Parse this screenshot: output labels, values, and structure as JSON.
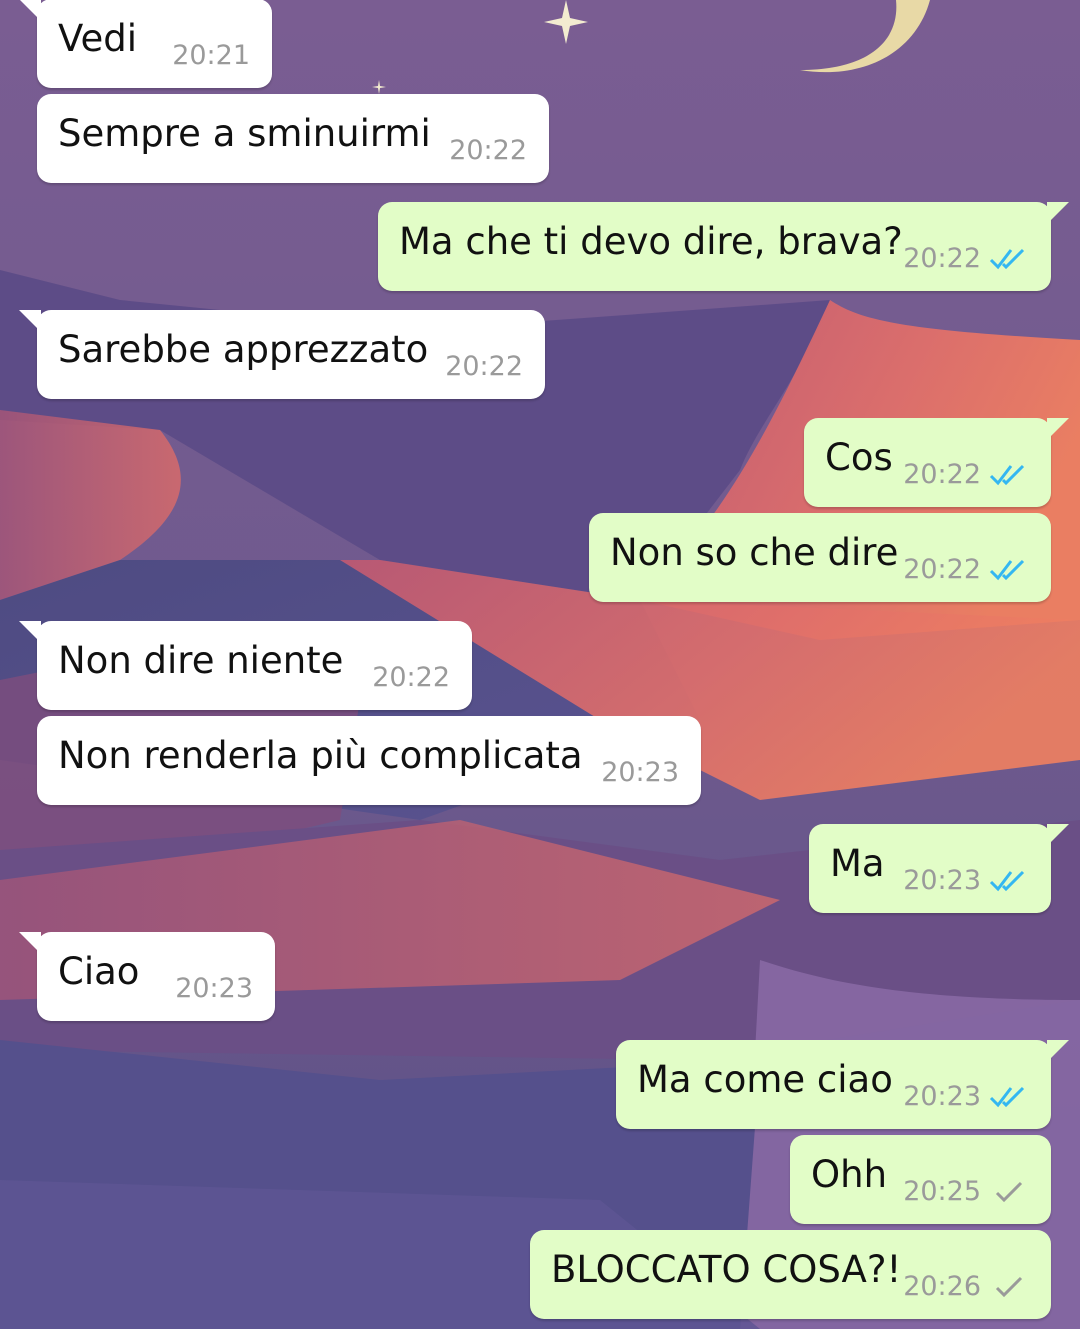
{
  "colors": {
    "incoming_bubble": "#ffffff",
    "outgoing_bubble": "#e2fdc7",
    "read_ticks": "#34b7f1",
    "sent_tick": "#9a9a9a",
    "time_text": "#9a9a9a"
  },
  "messages": [
    {
      "direction": "in",
      "text": "Vedi",
      "time": "20:21"
    },
    {
      "direction": "in",
      "text": "Sempre a sminuirmi",
      "time": "20:22"
    },
    {
      "direction": "out",
      "text": "Ma che ti devo dire, brava?",
      "time": "20:22",
      "status_icon": "double-check-read-icon"
    },
    {
      "direction": "in",
      "text": "Sarebbe apprezzato",
      "time": "20:22"
    },
    {
      "direction": "out",
      "text": "Cos",
      "time": "20:22",
      "status_icon": "double-check-read-icon"
    },
    {
      "direction": "out",
      "text": "Non so che dire",
      "time": "20:22",
      "status_icon": "double-check-read-icon"
    },
    {
      "direction": "in",
      "text": "Non dire niente",
      "time": "20:22"
    },
    {
      "direction": "in",
      "text": "Non renderla più complicata",
      "time": "20:23"
    },
    {
      "direction": "out",
      "text": "Ma",
      "time": "20:23",
      "status_icon": "double-check-read-icon"
    },
    {
      "direction": "in",
      "text": "Ciao",
      "time": "20:23"
    },
    {
      "direction": "out",
      "text": "Ma come ciao",
      "time": "20:23",
      "status_icon": "double-check-read-icon"
    },
    {
      "direction": "out",
      "text": "Ohh",
      "time": "20:25",
      "status_icon": "single-check-sent-icon"
    },
    {
      "direction": "out",
      "text": "BLOCCATO COSA?!",
      "time": "20:26",
      "status_icon": "single-check-sent-icon"
    }
  ]
}
